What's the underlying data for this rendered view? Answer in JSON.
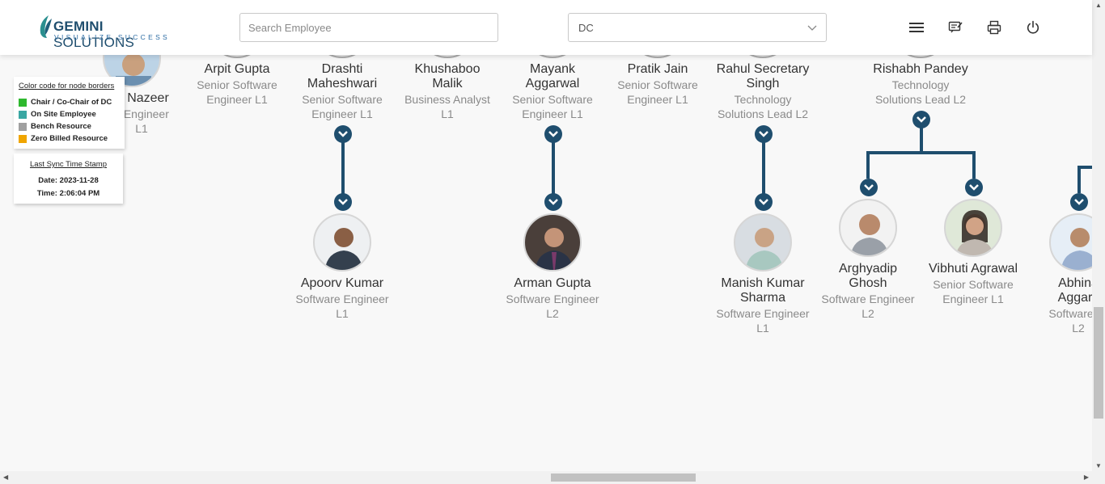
{
  "header": {
    "logo": {
      "brand": "GEMINI",
      "brand_suffix": " SOLUTIONS",
      "tagline": "VISUALIZE SUCCESS"
    },
    "search": {
      "placeholder": "Search Employee"
    },
    "dc_select": {
      "value": "DC"
    },
    "icons": [
      "menu-icon",
      "feedback-icon",
      "print-icon",
      "power-icon"
    ]
  },
  "legend": {
    "title": "Color code for node borders",
    "items": [
      {
        "label": "Chair / Co-Chair of DC",
        "color": "#2eb82e"
      },
      {
        "label": "On Site Employee",
        "color": "#3aa7a3"
      },
      {
        "label": "Bench Resource",
        "color": "#a0a0a0"
      },
      {
        "label": "Zero Billed Resource",
        "color": "#f0a500"
      }
    ]
  },
  "sync": {
    "title": "Last Sync Time Stamp",
    "date": "Date: 2023-11-28",
    "time": "Time: 2:06:04 PM"
  },
  "top_nodes": [
    {
      "name": "Nazeer",
      "role": "e Engineer",
      "role2": "L1"
    },
    {
      "name": "Arpit Gupta",
      "role": "Senior Software",
      "role2": "Engineer L1"
    },
    {
      "name": "Drashti",
      "name2": "Maheshwari",
      "role": "Senior Software",
      "role2": "Engineer L1"
    },
    {
      "name": "Khushaboo",
      "name2": "Malik",
      "role": "Business Analyst",
      "role2": "L1"
    },
    {
      "name": "Mayank",
      "name2": "Aggarwal",
      "role": "Senior Software",
      "role2": "Engineer L1"
    },
    {
      "name": "Pratik Jain",
      "role": "Senior Software",
      "role2": "Engineer L1"
    },
    {
      "name": "Rahul Secretary",
      "name2": "Singh",
      "role": "Technology",
      "role2": "Solutions Lead L2"
    },
    {
      "name": "Rishabh Pandey",
      "role": "Technology",
      "role2": "Solutions Lead L2"
    }
  ],
  "child_nodes": [
    {
      "name": "Apoorv Kumar",
      "role": "Software Engineer",
      "role2": "L1"
    },
    {
      "name": "Arman Gupta",
      "role": "Software Engineer",
      "role2": "L2"
    },
    {
      "name": "Manish Kumar",
      "name2": "Sharma",
      "role": "Software Engineer",
      "role2": "L1"
    },
    {
      "name": "Arghyadip",
      "name2": "Ghosh",
      "role": "Software Engineer",
      "role2": "L2"
    },
    {
      "name": "Vibhuti Agrawal",
      "role": "Senior Software",
      "role2": "Engineer L1"
    },
    {
      "name": "Abhina",
      "name2": "Aggarv",
      "role": "Software Er",
      "role2": "L2"
    }
  ]
}
